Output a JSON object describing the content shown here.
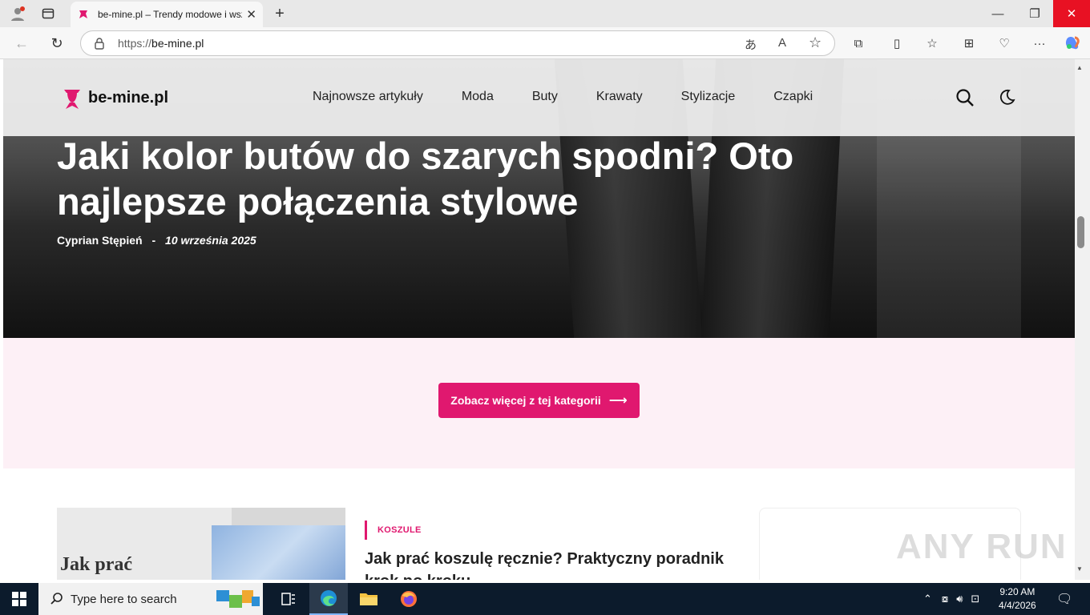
{
  "browser": {
    "tab_title": "be-mine.pl – Trendy modowe i wszystko",
    "url_protocol": "https://",
    "url_host": "be-mine.pl"
  },
  "site": {
    "logo_text": "be-mine.pl",
    "nav": [
      "Najnowsze artykuły",
      "Moda",
      "Buty",
      "Krawaty",
      "Stylizacje",
      "Czapki"
    ]
  },
  "hero": {
    "title": "Jaki kolor butów do szarych spodni? Oto najlepsze połączenia stylowe",
    "author": "Cyprian Stępień",
    "separator": "-",
    "date": "10 września 2025"
  },
  "cta": {
    "label": "Zobacz więcej z tej kategorii",
    "arrow": "⟶"
  },
  "article_card": {
    "image_text": "Jak prać",
    "category": "KOSZULE",
    "title": "Jak prać koszulę ręcznie? Praktyczny poradnik krok po kroku"
  },
  "watermark": "ANY RUN",
  "taskbar": {
    "search_placeholder": "Type here to search",
    "time": "9:20 AM",
    "date": "4/4/2026"
  },
  "colors": {
    "accent": "#e0186f",
    "pink_band": "#fdf0f6",
    "taskbar": "#0c1b2c"
  }
}
